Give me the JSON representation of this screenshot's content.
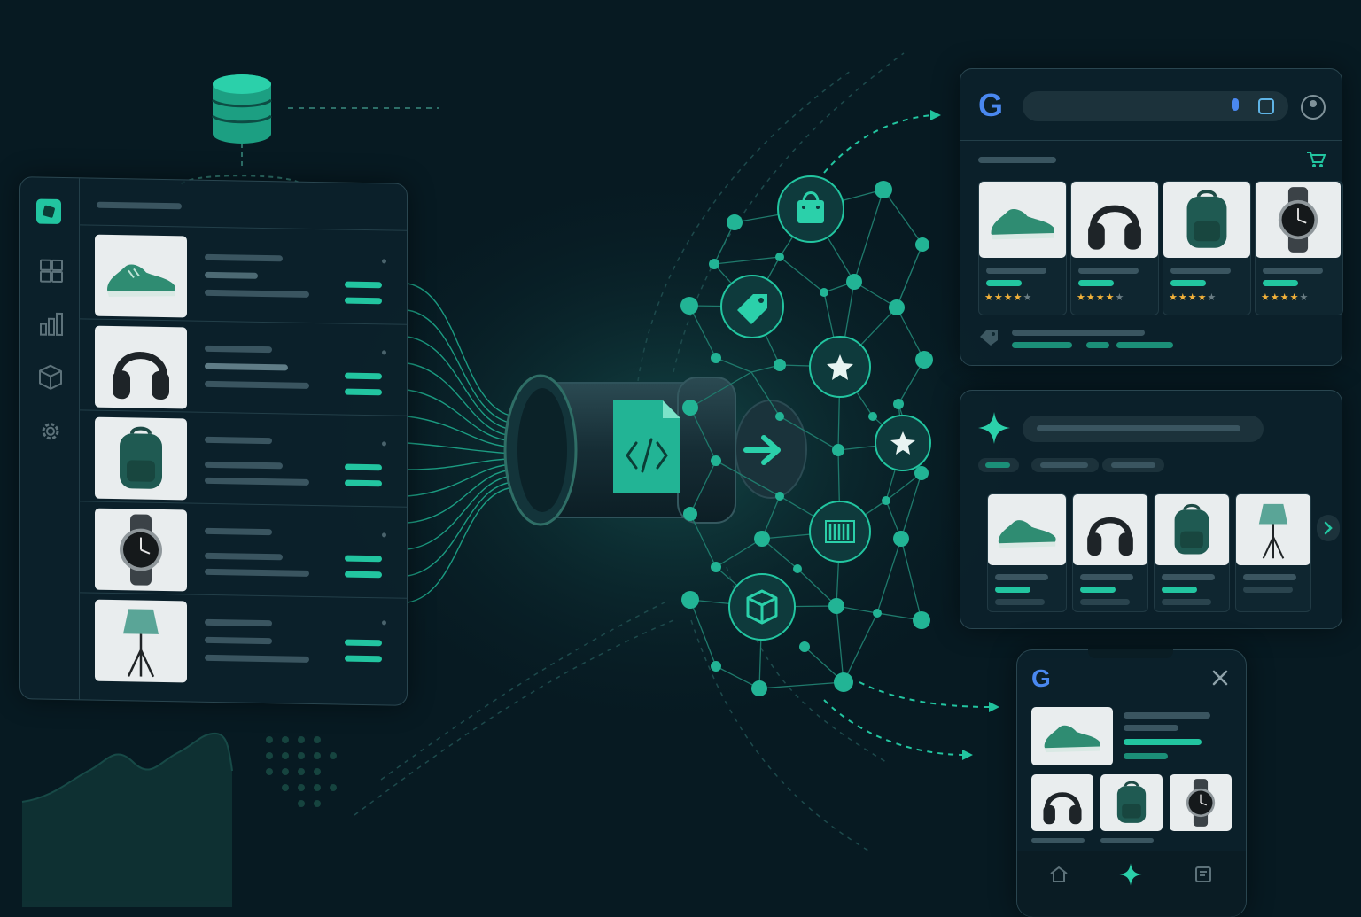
{
  "pipeline": {
    "feed_icon": "code-file-icon",
    "output_icon": "arrow-right-icon",
    "database_icon": "database-icon"
  },
  "catalog_panel": {
    "sidebar_icons": [
      "catalog-logo-icon",
      "grid-icon",
      "bar-chart-icon",
      "cube-icon",
      "gear-icon"
    ],
    "products": [
      "sneaker",
      "headphones",
      "backpack",
      "watch",
      "lamp"
    ]
  },
  "graph_nodes": [
    "shopping-bag-icon",
    "price-tag-icon",
    "star-icon",
    "star-icon",
    "barcode-icon",
    "box-icon"
  ],
  "search_results_panel": {
    "logo_text": "G",
    "icons": [
      "mic-icon",
      "lens-icon",
      "account-icon",
      "cart-icon",
      "tag-icon"
    ],
    "ratings": [
      4,
      4,
      4,
      4
    ]
  },
  "ai_panel": {
    "icons": [
      "sparkle-icon",
      "chevron-right-icon"
    ]
  },
  "mobile_panel": {
    "logo_text": "G",
    "icons": [
      "close-icon",
      "home-icon",
      "sparkle-icon",
      "bookmark-icon"
    ]
  },
  "colors": {
    "background": "#071a22",
    "accent": "#22c5a0",
    "panel_border": "#2a4650"
  }
}
